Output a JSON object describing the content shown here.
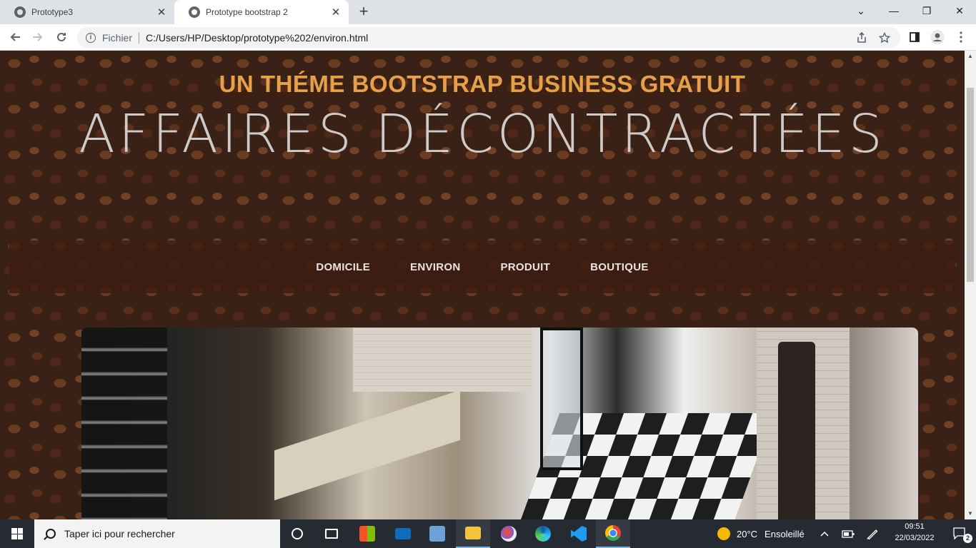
{
  "browser": {
    "tabs": [
      {
        "title": "Prototype3",
        "active": false
      },
      {
        "title": "Prototype bootstrap 2",
        "active": true
      }
    ],
    "new_tab_glyph": "+",
    "window_controls": {
      "minimize": "—",
      "restore": "❐",
      "close": "✕",
      "tab_search": "⌄"
    },
    "address": {
      "scheme_label": "Fichier",
      "url": "C:/Users/HP/Desktop/prototype%202/environ.html"
    }
  },
  "page": {
    "tagline_upper": "UN THÉME BOOTSTRAP BUSINESS GRATUIT",
    "tagline_main": "AFFAIRES DÉCONTRACTÉES",
    "nav": [
      {
        "label": "DOMICILE"
      },
      {
        "label": "ENVIRON"
      },
      {
        "label": "PRODUIT"
      },
      {
        "label": "BOUTIQUE"
      }
    ],
    "colors": {
      "accent": "#e6a04a",
      "nav_bg": "#3c1c10",
      "title": "#e8e8e8"
    }
  },
  "taskbar": {
    "search_placeholder": "Taper ici pour rechercher",
    "weather": {
      "temp": "20°C",
      "condition": "Ensoleillé"
    },
    "time": "09:51",
    "date": "22/03/2022",
    "notifications_count": "2",
    "pinned": [
      {
        "name": "task-view-icon"
      },
      {
        "name": "widgets-icon"
      },
      {
        "name": "microsoft-store-icon"
      },
      {
        "name": "mail-icon"
      },
      {
        "name": "remote-desktop-icon"
      },
      {
        "name": "file-explorer-icon"
      },
      {
        "name": "paint-icon"
      },
      {
        "name": "edge-icon"
      },
      {
        "name": "vscode-icon"
      },
      {
        "name": "chrome-icon"
      }
    ]
  }
}
